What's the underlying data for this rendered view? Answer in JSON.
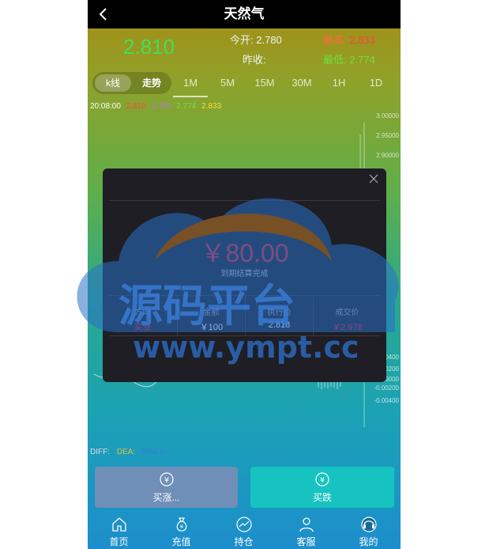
{
  "header": {
    "title": "天然气"
  },
  "quote": {
    "price": "2.810",
    "open_label": "今开:",
    "open": "2.780",
    "high_label": "最高:",
    "high": "2.833",
    "prevclose_label": "昨收:",
    "prevclose": "",
    "low_label": "最低:",
    "low": "2.774"
  },
  "chart_mode": {
    "kline": "k线",
    "trend": "走势"
  },
  "periods": [
    "1M",
    "5M",
    "15M",
    "30M",
    "1H",
    "1D"
  ],
  "info_line": {
    "time": "20:08:00",
    "v1": "2.810",
    "v2": "2.780",
    "v3": "2.774",
    "v4": "2.833"
  },
  "yaxis_labels": [
    "3.00000",
    "2.95000",
    "2.90000",
    "0.00400",
    "0.00200",
    "0.00000",
    "-0.00200",
    "-0.00400"
  ],
  "macd": {
    "diff": "DIFF:",
    "dea": "DEA:",
    "macd": "MACD:"
  },
  "modal": {
    "amount": "￥80.00",
    "status": "到期结算完成",
    "headers": [
      "方向",
      "金额",
      "执行价",
      "成交价"
    ],
    "values": [
      "买涨",
      "￥100",
      "2.818",
      "￥2.978"
    ]
  },
  "watermark": {
    "text": "源码平台",
    "url": "www.ympt.cc"
  },
  "actions": {
    "buy_up": "买涨...",
    "buy_down": "买跌"
  },
  "nav": [
    "首页",
    "充值",
    "持仓",
    "客服",
    "我的"
  ],
  "colors": {
    "up": "#e8202a",
    "down": "#3ee05a",
    "buy_btn": "#6f8fb8",
    "sell_btn": "#17c3c0",
    "header_bg": "#000000"
  }
}
